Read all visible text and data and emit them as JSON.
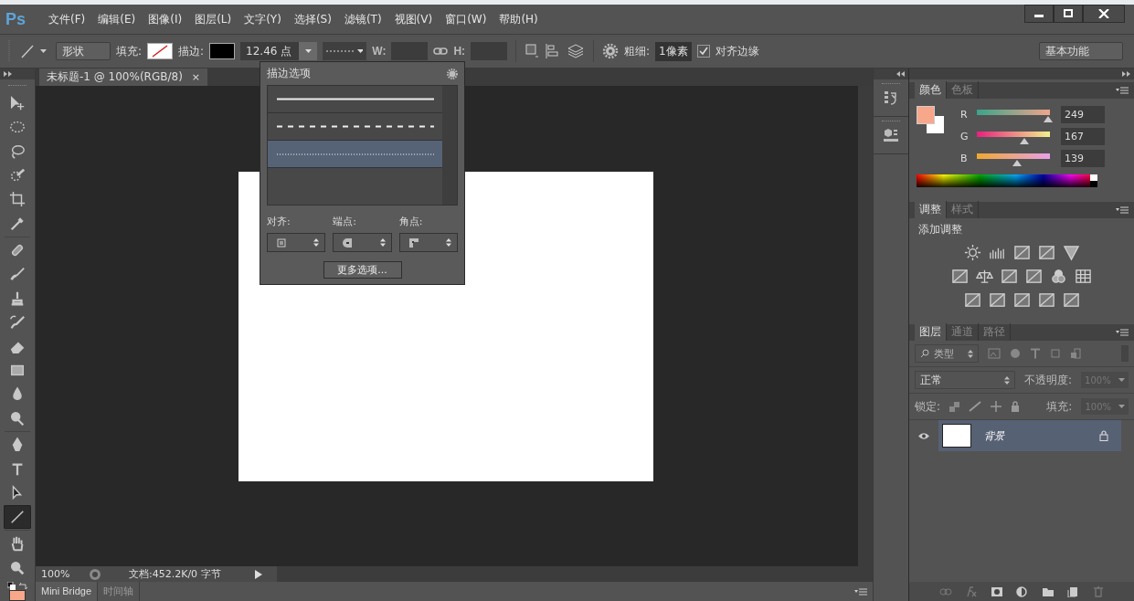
{
  "app_logo": "Ps",
  "menu": [
    "文件(F)",
    "编辑(E)",
    "图像(I)",
    "图层(L)",
    "文字(Y)",
    "选择(S)",
    "滤镜(T)",
    "视图(V)",
    "窗口(W)",
    "帮助(H)"
  ],
  "options_bar": {
    "mode": "形状",
    "fill_label": "填充:",
    "stroke_label": "描边:",
    "stroke_width": "12.46 点",
    "w_label": "W:",
    "h_label": "H:",
    "weight_label": "粗细:",
    "weight": "1像素",
    "align_edges": {
      "label": "对齐边缘",
      "checked": true
    },
    "workspace": "基本功能"
  },
  "document_tab": {
    "title": "未标题-1 @ 100%(RGB/8)",
    "close": "×"
  },
  "tools": [
    {
      "kind": "move",
      "selected": false
    },
    {
      "kind": "marquee",
      "selected": false
    },
    {
      "kind": "lasso",
      "selected": false
    },
    {
      "kind": "quickselect",
      "selected": false
    },
    {
      "kind": "crop",
      "selected": false
    },
    {
      "kind": "eyedropper",
      "selected": false
    },
    {
      "kind": "healing",
      "selected": false
    },
    {
      "kind": "brush",
      "selected": false
    },
    {
      "kind": "stamp",
      "selected": false
    },
    {
      "kind": "historybrush",
      "selected": false
    },
    {
      "kind": "eraser",
      "selected": false
    },
    {
      "kind": "gradient",
      "selected": false
    },
    {
      "kind": "blur",
      "selected": false
    },
    {
      "kind": "dodge",
      "selected": false
    },
    {
      "kind": "pen",
      "selected": false
    },
    {
      "kind": "type",
      "selected": false
    },
    {
      "kind": "pathselect",
      "selected": false
    },
    {
      "kind": "line",
      "selected": true
    },
    {
      "kind": "hand",
      "selected": false
    },
    {
      "kind": "zoom",
      "selected": false
    }
  ],
  "stroke_popup": {
    "title": "描边选项",
    "styles": [
      {
        "kind": "solid",
        "selected": false
      },
      {
        "kind": "dashed",
        "selected": false
      },
      {
        "kind": "dotted",
        "selected": true
      }
    ],
    "align_label": "对齐:",
    "caps_label": "端点:",
    "corners_label": "角点:",
    "more_button": "更多选项..."
  },
  "status_bar": {
    "zoom": "100%",
    "doc_info": "文档:452.2K/0 字节"
  },
  "bottom_tabs": [
    {
      "label": "Mini Bridge",
      "selected": true
    },
    {
      "label": "时间轴",
      "selected": false
    }
  ],
  "color_panel": {
    "tabs": [
      {
        "label": "颜色",
        "selected": true
      },
      {
        "label": "色板",
        "selected": false
      }
    ],
    "channels": [
      {
        "name": "R",
        "level": 0.976,
        "reading": "249"
      },
      {
        "name": "G",
        "level": 0.655,
        "reading": "167"
      },
      {
        "name": "B",
        "level": 0.545,
        "reading": "139"
      }
    ]
  },
  "adjustments_panel": {
    "tabs": [
      {
        "label": "调整",
        "selected": true
      },
      {
        "label": "样式",
        "selected": false
      }
    ],
    "heading": "添加调整"
  },
  "layers_panel": {
    "tabs": [
      {
        "label": "图层",
        "selected": true
      },
      {
        "label": "通道",
        "selected": false
      },
      {
        "label": "路径",
        "selected": false
      }
    ],
    "filter": "类型",
    "blend_mode": "正常",
    "opacity_label": "不透明度:",
    "opacity": "100%",
    "lock_label": "锁定:",
    "fill_label": "填充:",
    "fill": "100%",
    "layers": [
      {
        "name": "背景",
        "visible": true,
        "locked": true,
        "selected": true
      }
    ]
  }
}
